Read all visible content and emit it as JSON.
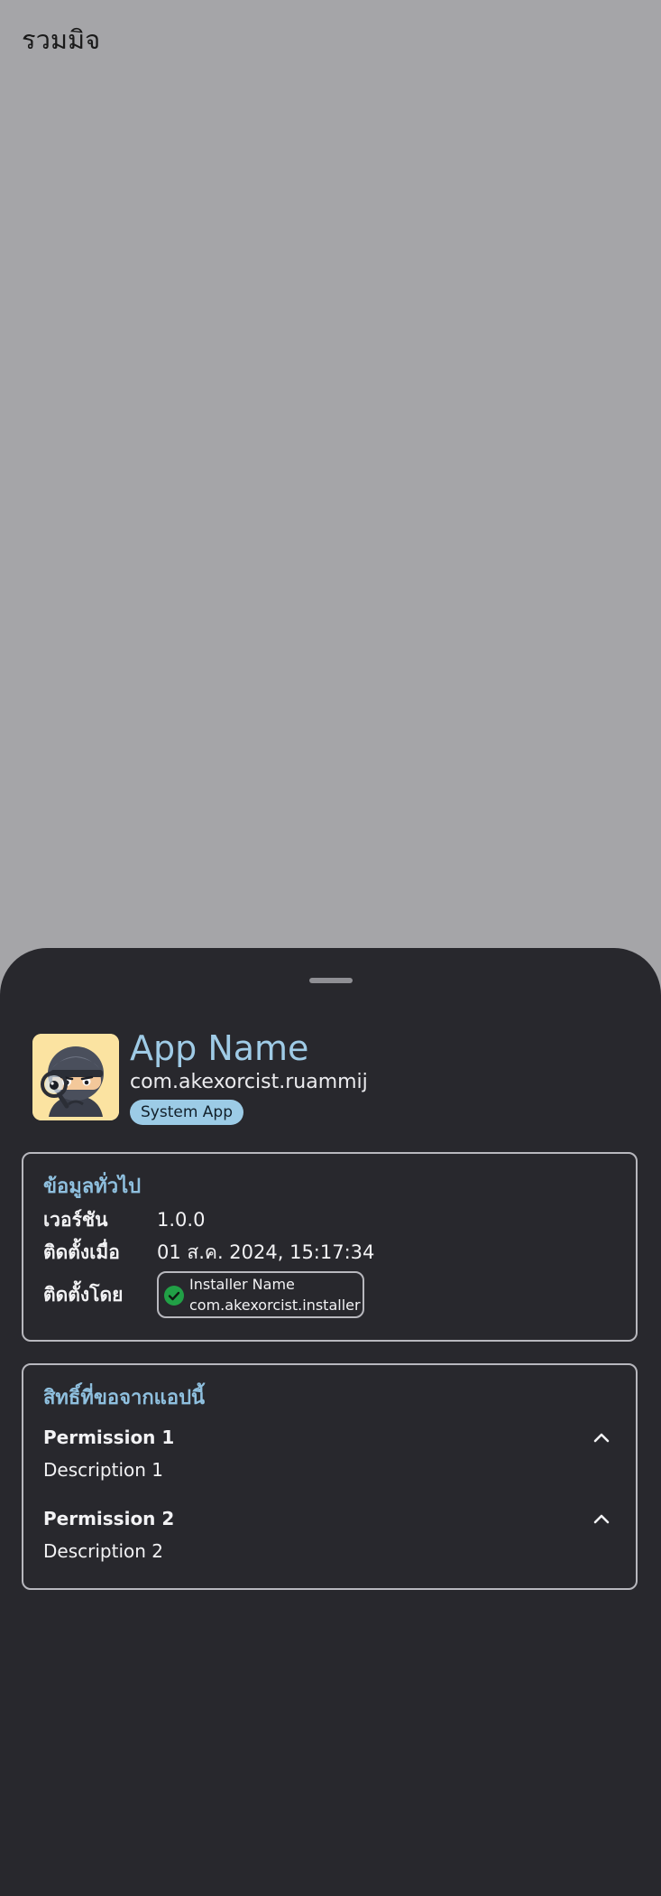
{
  "screen": {
    "title": "รวมมิจ"
  },
  "sheet": {
    "app": {
      "name": "App Name",
      "package": "com.akexorcist.ruammij",
      "badge": "System App",
      "icon": "ninja-detective-icon"
    },
    "general_info": {
      "title": "ข้อมูลทั่วไป",
      "rows": [
        {
          "label": "เวอร์ชัน",
          "value": "1.0.0"
        },
        {
          "label": "ติดตั้งเมื่อ",
          "value": "01 ส.ค. 2024, 15:17:34"
        },
        {
          "label": "ติดตั้งโดย"
        }
      ],
      "installer": {
        "name": "Installer Name",
        "package": "com.akexorcist.installer",
        "icon": "verified-check-icon"
      }
    },
    "permissions": {
      "title": "สิทธิ์ที่ขอจากแอปนี้",
      "items": [
        {
          "name": "Permission 1",
          "description": "Description 1"
        },
        {
          "name": "Permission 2",
          "description": "Description 2"
        }
      ]
    }
  },
  "colors": {
    "scrim": "#a5a5a8",
    "sheet_background": "#28282d",
    "accent": "#9fcbe6",
    "chip_background": "#9ccbe6",
    "verified_green": "#21a046",
    "border": "#b8b8be"
  }
}
